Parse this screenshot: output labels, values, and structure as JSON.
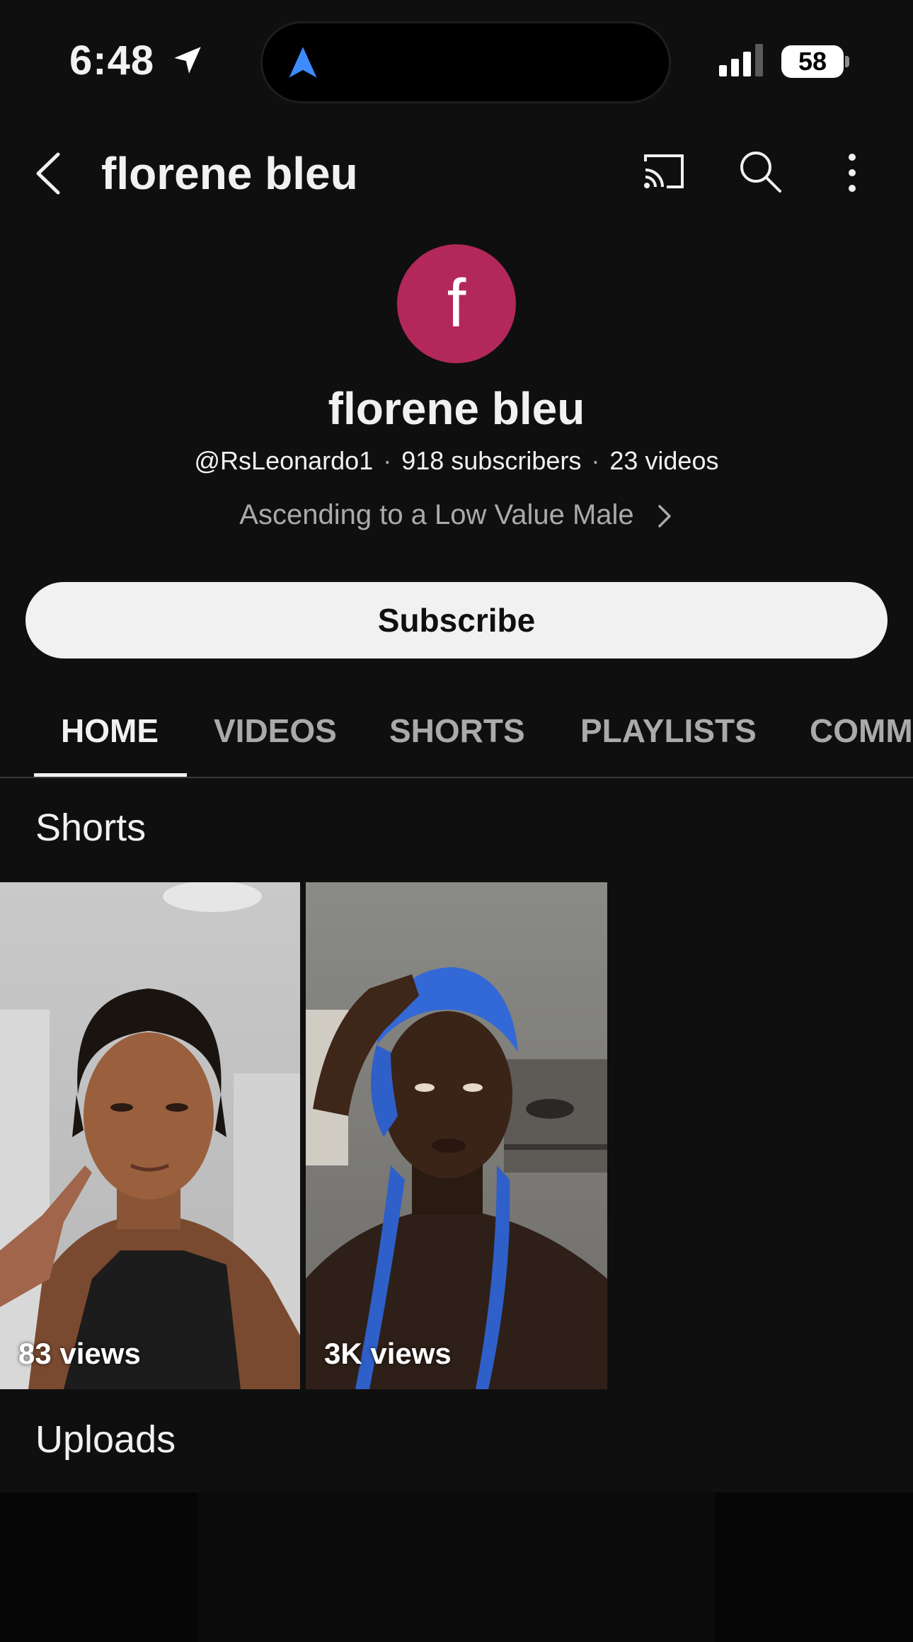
{
  "status_bar": {
    "time": "6:48",
    "battery": "58"
  },
  "app_bar": {
    "title": "florene bleu"
  },
  "channel": {
    "avatar_letter": "f",
    "avatar_color": "#b3285a",
    "name": "florene bleu",
    "handle": "@RsLeonardo1",
    "subscribers": "918 subscribers",
    "videos": "23 videos",
    "tagline": "Ascending to a Low Value Male"
  },
  "subscribe_label": "Subscribe",
  "tabs": [
    {
      "label": "HOME",
      "active": true
    },
    {
      "label": "VIDEOS"
    },
    {
      "label": "SHORTS"
    },
    {
      "label": "PLAYLISTS"
    },
    {
      "label": "COMMUNITY"
    }
  ],
  "sections": {
    "shorts_title": "Shorts",
    "uploads_title": "Uploads"
  },
  "shorts": [
    {
      "views": "83 views"
    },
    {
      "views": "3K views"
    }
  ],
  "icons": [
    "location-arrow-icon",
    "navigation-arrow-icon",
    "signal-icon",
    "battery-icon",
    "back-icon",
    "cast-icon",
    "search-icon",
    "more-icon",
    "chevron-right-icon"
  ]
}
